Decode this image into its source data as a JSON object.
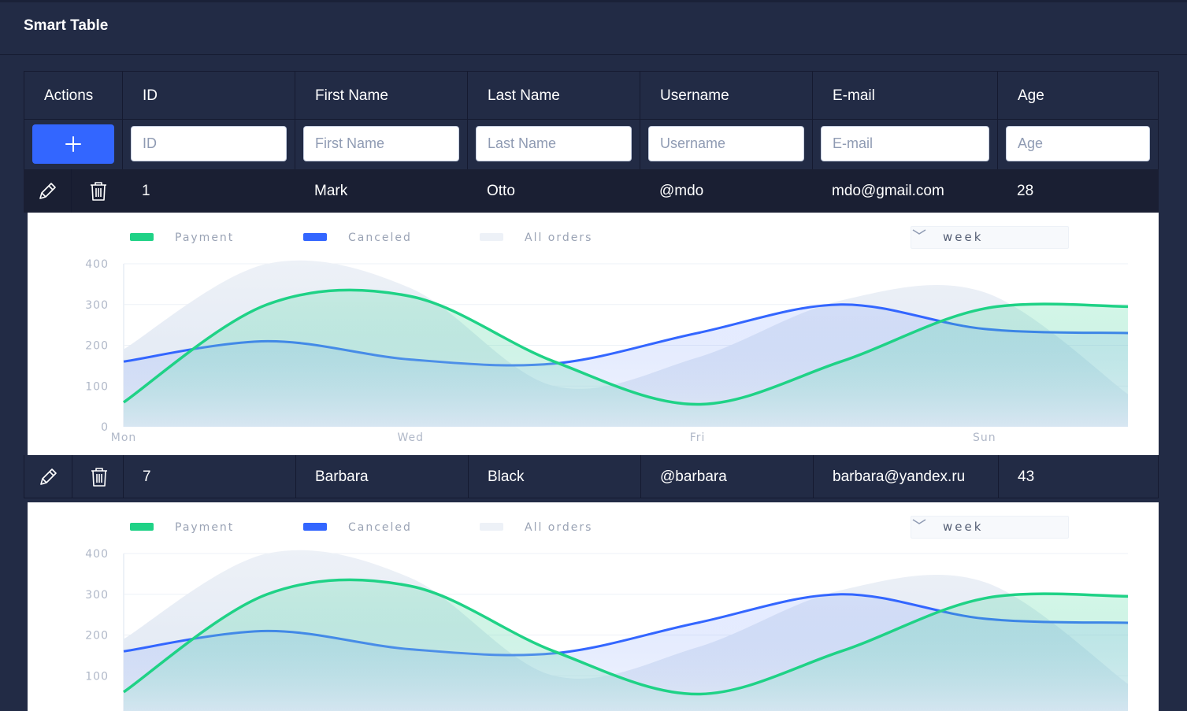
{
  "header": {
    "title": "Smart Table"
  },
  "columns": [
    "Actions",
    "ID",
    "First Name",
    "Last Name",
    "Username",
    "E-mail",
    "Age"
  ],
  "filters": {
    "id": "ID",
    "first_name": "First Name",
    "last_name": "Last Name",
    "username": "Username",
    "email": "E-mail",
    "age": "Age"
  },
  "rows": [
    {
      "id": "1",
      "first_name": "Mark",
      "last_name": "Otto",
      "username": "@mdo",
      "email": "mdo@gmail.com",
      "age": "28"
    },
    {
      "id": "7",
      "first_name": "Barbara",
      "last_name": "Black",
      "username": "@barbara",
      "email": "barbara@yandex.ru",
      "age": "43"
    }
  ],
  "chart": {
    "legend": [
      "Payment",
      "Canceled",
      "All orders"
    ],
    "period": "week",
    "yticks": [
      "400",
      "300",
      "200",
      "100",
      "0"
    ],
    "xticks": [
      "Mon",
      "Wed",
      "Fri",
      "Sun"
    ]
  },
  "colors": {
    "background": "#222b45",
    "accent": "#3366ff",
    "payment": "#1fd286",
    "canceled": "#3366ff",
    "all_orders": "#edf1f7"
  },
  "chart_data": {
    "type": "area",
    "x": [
      "Mon",
      "",
      "Wed",
      "",
      "Fri",
      "",
      "Sun",
      ""
    ],
    "ylim": [
      0,
      400
    ],
    "legend_placement": "top-left",
    "series": [
      {
        "name": "Payment",
        "values": [
          60,
          300,
          320,
          160,
          55,
          160,
          290,
          295
        ]
      },
      {
        "name": "Canceled",
        "values": [
          160,
          210,
          165,
          155,
          230,
          300,
          240,
          230
        ]
      },
      {
        "name": "All orders",
        "values": [
          190,
          400,
          340,
          100,
          170,
          310,
          330,
          80
        ]
      }
    ]
  }
}
